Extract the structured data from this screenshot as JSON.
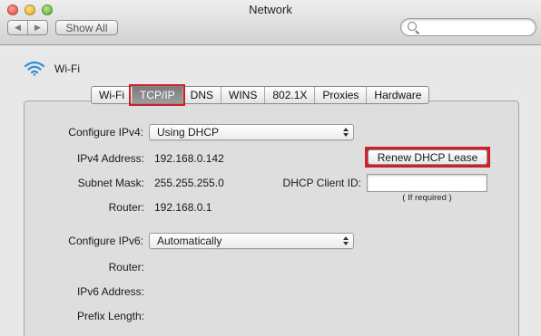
{
  "window": {
    "title": "Network"
  },
  "toolbar": {
    "back_glyph": "◀",
    "forward_glyph": "▶",
    "show_all_label": "Show All",
    "search_placeholder": ""
  },
  "interface": {
    "name": "Wi-Fi",
    "icon": "wifi-icon"
  },
  "tabs": [
    {
      "label": "Wi-Fi",
      "selected": false
    },
    {
      "label": "TCP/IP",
      "selected": true
    },
    {
      "label": "DNS",
      "selected": false
    },
    {
      "label": "WINS",
      "selected": false
    },
    {
      "label": "802.1X",
      "selected": false
    },
    {
      "label": "Proxies",
      "selected": false
    },
    {
      "label": "Hardware",
      "selected": false
    }
  ],
  "ipv4": {
    "configure_label": "Configure IPv4:",
    "configure_value": "Using DHCP",
    "address_label": "IPv4 Address:",
    "address_value": "192.168.0.142",
    "subnet_label": "Subnet Mask:",
    "subnet_value": "255.255.255.0",
    "router_label": "Router:",
    "router_value": "192.168.0.1",
    "renew_button_label": "Renew DHCP Lease",
    "client_id_label": "DHCP Client ID:",
    "client_id_value": "",
    "client_id_hint": "( If required )"
  },
  "ipv6": {
    "configure_label": "Configure IPv6:",
    "configure_value": "Automatically",
    "router_label": "Router:",
    "address_label": "IPv6 Address:",
    "prefix_label": "Prefix Length:"
  },
  "colors": {
    "highlight": "#cf1f2a",
    "selected_tab": "#8a8a8a",
    "wifi_icon": "#2f8fd8"
  }
}
